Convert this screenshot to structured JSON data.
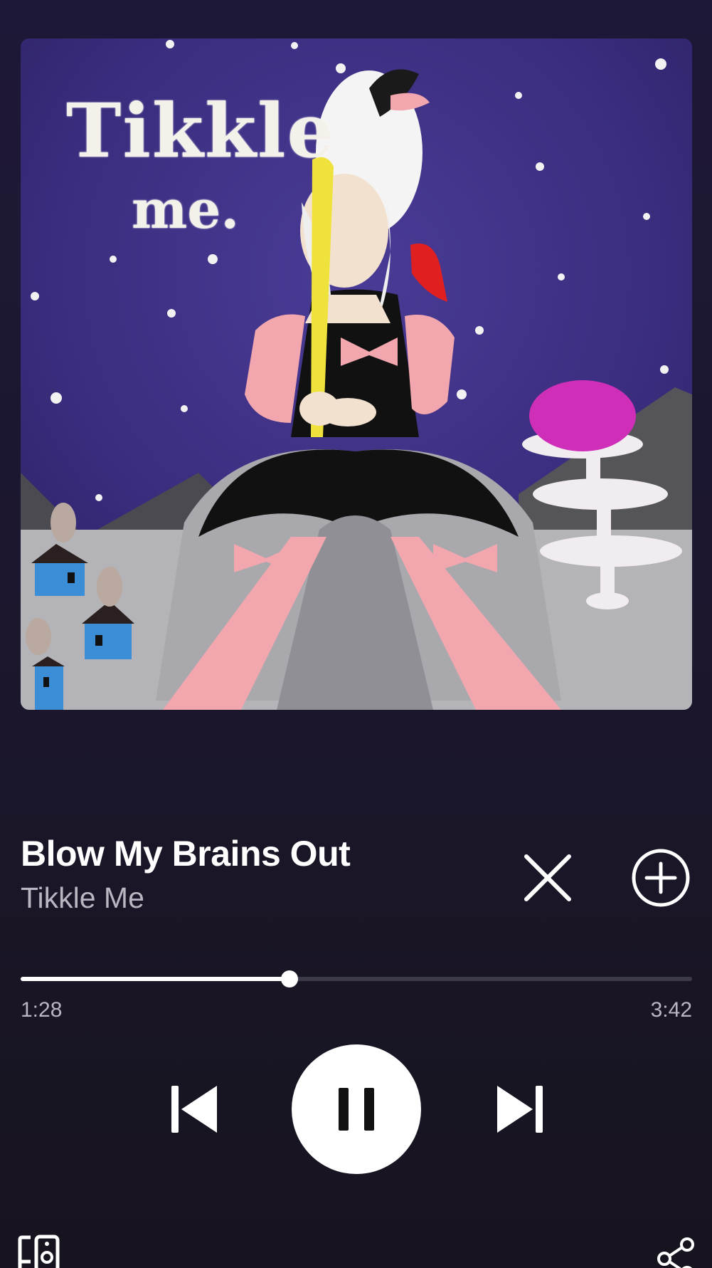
{
  "album_art": {
    "title_line1": "Tikkle",
    "title_line2": "me."
  },
  "track": {
    "title": "Blow My Brains Out",
    "artist": "Tikkle Me"
  },
  "progress": {
    "elapsed": "1:28",
    "total": "3:42",
    "fraction": 0.4
  },
  "playback_state": "playing",
  "icons": {
    "remove": "close-icon",
    "add": "plus-circle-icon",
    "previous": "skip-previous-icon",
    "play_pause": "pause-icon",
    "next": "skip-next-icon",
    "devices": "connect-device-icon",
    "share": "share-icon"
  },
  "colors": {
    "background": "#1c172e",
    "primary_text": "#ffffff",
    "secondary_text": "#b9b6c2",
    "progress_track": "#3c3948",
    "progress_fill": "#ffffff"
  }
}
